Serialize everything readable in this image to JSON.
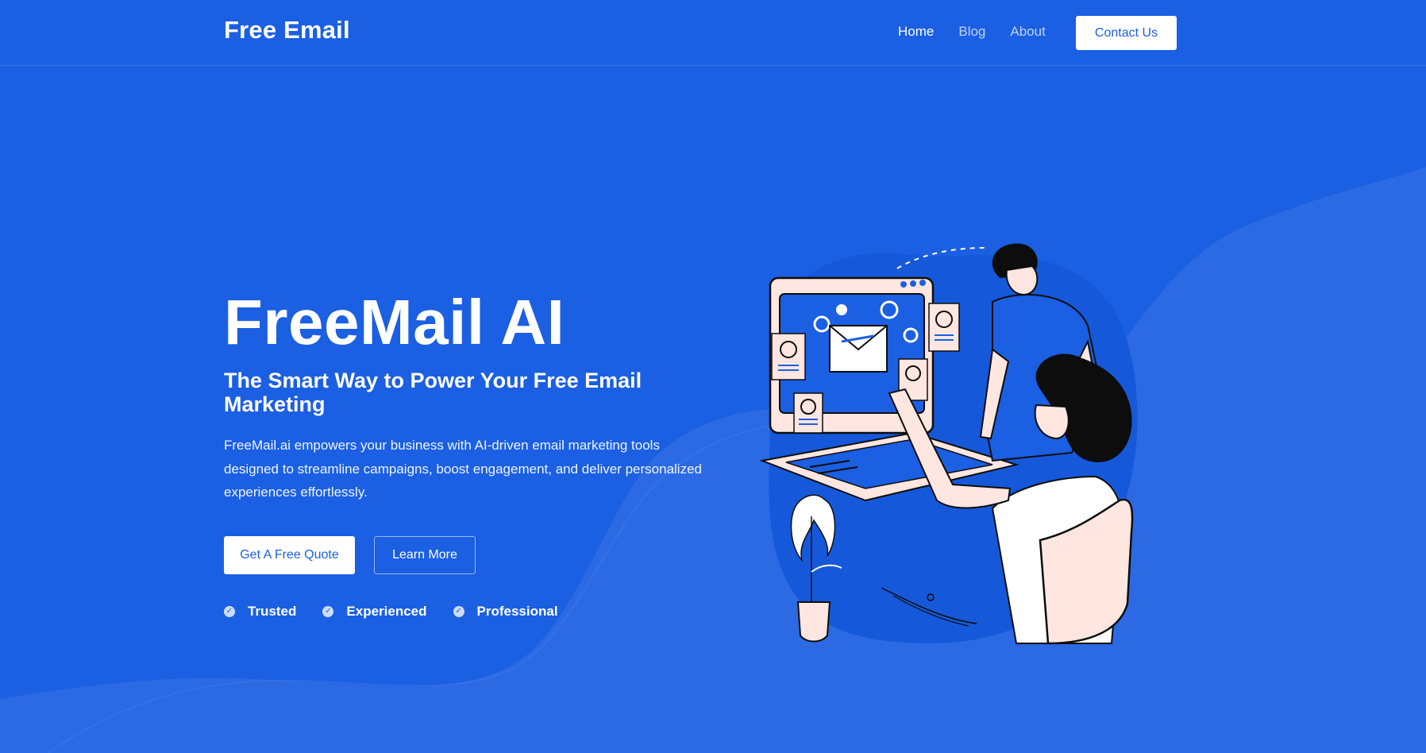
{
  "brand": "Free Email",
  "nav": {
    "links": [
      "Home",
      "Blog",
      "About"
    ],
    "contact_label": "Contact Us"
  },
  "hero": {
    "title": "FreeMail AI",
    "subtitle": "The Smart Way to Power Your Free Email Marketing",
    "description": "FreeMail.ai empowers your business with AI-driven email marketing tools designed to streamline campaigns, boost engagement, and deliver personalized experiences effortlessly.",
    "cta_primary": "Get A Free Quote",
    "cta_secondary": "Learn More",
    "features": [
      "Trusted",
      "Experienced",
      "Professional"
    ]
  },
  "colors": {
    "background": "#1b5fe2",
    "wave": "#3a72e6",
    "button_text": "#1b5fe2",
    "illustration_skin": "#ffe6e0",
    "illustration_shirt": "#1b5fe2",
    "illustration_hair": "#0d0d0d"
  },
  "icons": {
    "feature_check": "check-circle-icon"
  }
}
